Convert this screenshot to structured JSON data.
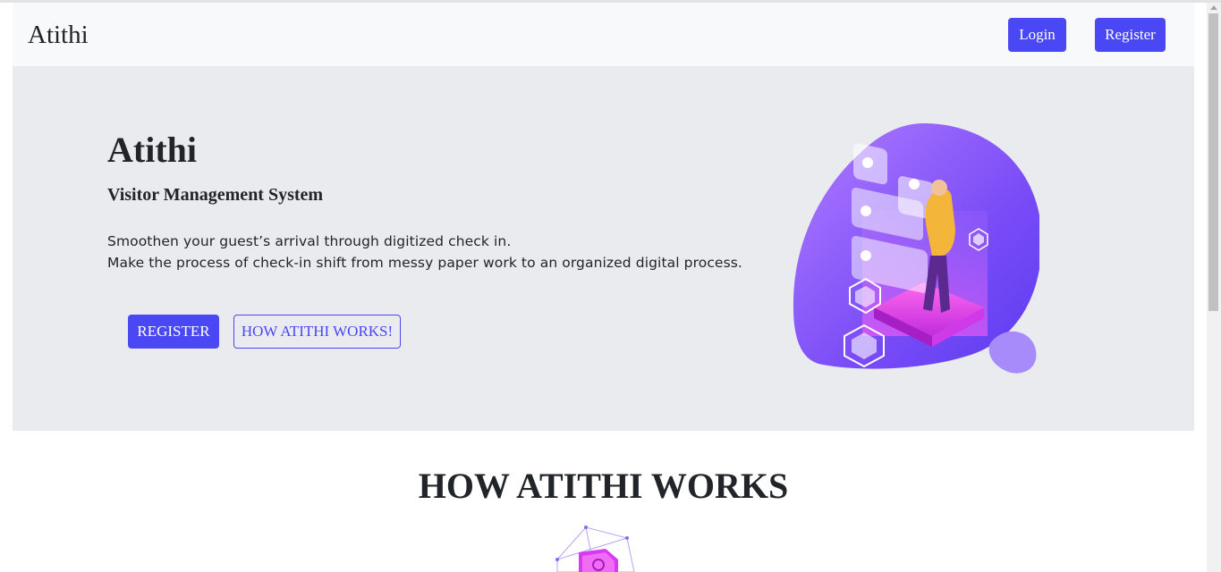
{
  "navbar": {
    "brand": "Atithi",
    "login_label": "Login",
    "register_label": "Register"
  },
  "hero": {
    "title": "Atithi",
    "subtitle": "Visitor Management System",
    "text_line1": "Smoothen your guest’s arrival through digitized check in.",
    "text_line2": "Make the process of check-in shift from messy paper work to an organized digital process.",
    "register_button": "REGISTER",
    "how_button": "HOW ATITHI WORKS!",
    "illustration_icon": "person-with-floating-cards-illustration"
  },
  "section": {
    "title": "HOW ATITHI WORKS",
    "illustration_icon": "isometric-device-illustration"
  },
  "colors": {
    "accent": "#4a47f5",
    "hero_bg": "#e9ebee",
    "navbar_bg": "#f8f9fa",
    "purple": "#8a4dff",
    "magenta": "#d63af2"
  }
}
